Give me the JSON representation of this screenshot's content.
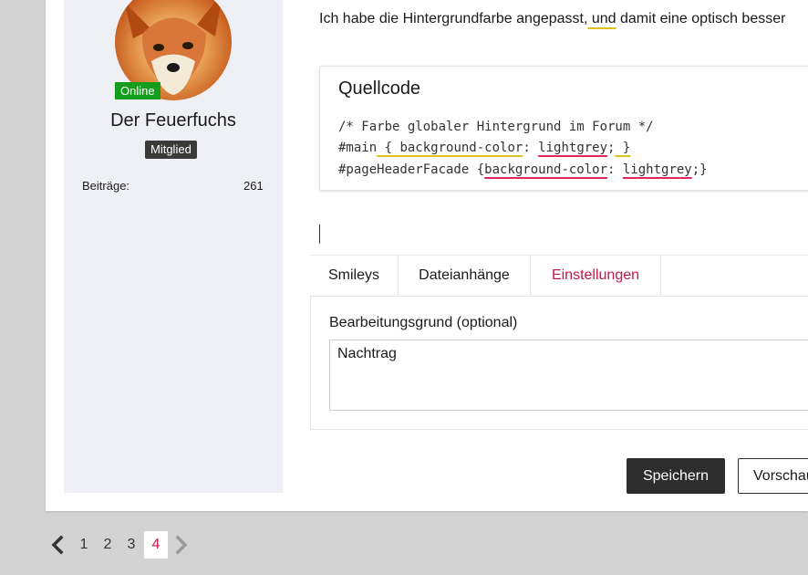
{
  "author": {
    "online_label": "Online",
    "name": "Der Feuerfuchs",
    "role": "Mitglied",
    "stats_label": "Beiträge:",
    "stats_value": "261",
    "avatar_icon": "fox-avatar"
  },
  "post": {
    "intro_before": "Ich habe die Hintergrundfarbe angepasst,",
    "intro_underlined": " und",
    "intro_after": " damit eine optisch besser"
  },
  "code": {
    "title": "Quellcode",
    "line1": "/* Farbe globaler Hintergrund im Forum */",
    "line2_a": "#main",
    "line2_b": " { background-color",
    "line2_c": ": ",
    "line2_d": "lightgrey",
    "line2_e": ";",
    "line2_f": " }",
    "line3_a": "#pageHeaderFacade {",
    "line3_b": "background-color",
    "line3_c": ": ",
    "line3_d": "lightgrey",
    "line3_e": ";}"
  },
  "tabs": [
    {
      "label": "Smileys"
    },
    {
      "label": "Dateianhänge"
    },
    {
      "label": "Einstellungen",
      "active": true
    }
  ],
  "settings": {
    "reason_label": "Bearbeitungsgrund (optional)",
    "reason_value": "Nachtrag"
  },
  "actions": {
    "save_label": "Speichern",
    "preview_label": "Vorschau"
  },
  "pagination": {
    "pages": [
      "1",
      "2",
      "3",
      "4"
    ],
    "current": "4",
    "prev_icon": "chevron-left-icon",
    "next_icon": "chevron-right-icon"
  },
  "colors": {
    "accent": "#c4184b",
    "online": "#149c1c",
    "underline_yellow": "#e0c020",
    "underline_red": "#e0285a"
  }
}
